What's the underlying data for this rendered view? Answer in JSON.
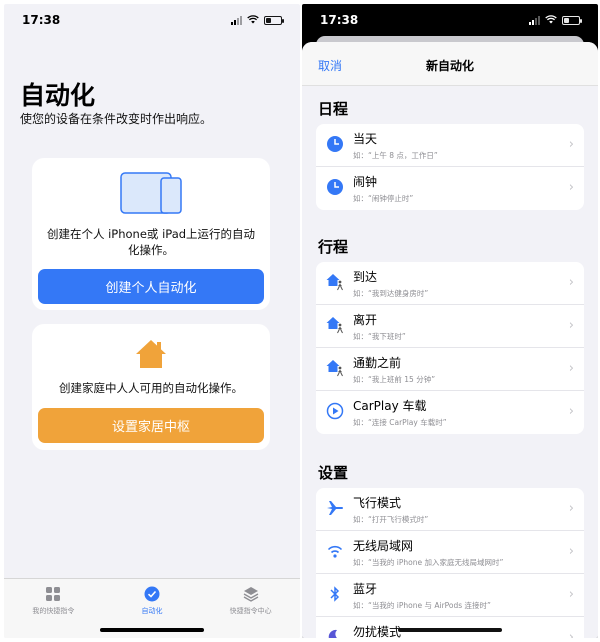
{
  "left": {
    "status": {
      "time": "17:38"
    },
    "title": "自动化",
    "subtitle": "使您的设备在条件改变时作出响应。",
    "personal_card": {
      "text": "创建在个人 iPhone或 iPad上运行的自动化操作。",
      "button": "创建个人自动化"
    },
    "home_card": {
      "text": "创建家庭中人人可用的自动化操作。",
      "button": "设置家居中枢"
    },
    "tabs": [
      {
        "label": "我的快捷指令",
        "icon": "grid-icon"
      },
      {
        "label": "自动化",
        "icon": "checkmark-circle-icon"
      },
      {
        "label": "快捷指令中心",
        "icon": "layers-icon"
      }
    ],
    "colors": {
      "accent": "#3478f6",
      "home_button": "#f0a33a"
    }
  },
  "right": {
    "status": {
      "time": "17:38"
    },
    "nav": {
      "cancel": "取消",
      "title": "新自动化"
    },
    "sections": [
      {
        "title": "日程",
        "rows": [
          {
            "title": "当天",
            "desc": "如：“上午 8 点，工作日”",
            "icon": "clock-icon"
          },
          {
            "title": "闹钟",
            "desc": "如：“闹钟停止时”",
            "icon": "clock-icon"
          }
        ]
      },
      {
        "title": "行程",
        "rows": [
          {
            "title": "到达",
            "desc": "如：“我到达健身房时”",
            "icon": "arrive-icon"
          },
          {
            "title": "离开",
            "desc": "如：“我下班时”",
            "icon": "leave-icon"
          },
          {
            "title": "通勤之前",
            "desc": "如：“我上班前 15 分钟”",
            "icon": "commute-icon"
          },
          {
            "title": "CarPlay 车载",
            "desc": "如：“连接 CarPlay 车载时”",
            "icon": "carplay-icon"
          }
        ]
      },
      {
        "title": "设置",
        "rows": [
          {
            "title": "飞行模式",
            "desc": "如：“打开飞行模式时”",
            "icon": "airplane-icon"
          },
          {
            "title": "无线局域网",
            "desc": "如：“当我的 iPhone 加入家庭无线局域网时”",
            "icon": "wifi-icon"
          },
          {
            "title": "蓝牙",
            "desc": "如：“当我的 iPhone 与 AirPods 连接时”",
            "icon": "bluetooth-icon"
          },
          {
            "title": "勿扰模式",
            "desc": "",
            "icon": "moon-icon"
          }
        ]
      }
    ]
  }
}
